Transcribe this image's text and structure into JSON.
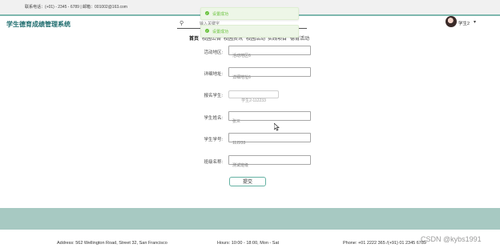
{
  "topbar": {
    "contact": "联系电话：(+01) - 2345 - 6789 | 邮箱：001002@163.com"
  },
  "brand": {
    "title": "学生德育成绩管理系统"
  },
  "search": {
    "placeholder": "输入关键字"
  },
  "user": {
    "name": "学生2",
    "caret": "▾"
  },
  "nav": {
    "items": [
      "首页",
      "校园公告",
      "校园资讯",
      "校园活动",
      "实践项目",
      "德育活动"
    ]
  },
  "toasts": [
    {
      "text": "设置成功"
    },
    {
      "text": "设置成功"
    }
  ],
  "form": {
    "fields": [
      {
        "label": "活动地区:",
        "value": "活动地区6"
      },
      {
        "label": "详细地址:",
        "value": "详细地址6"
      },
      {
        "label": "报名学生:",
        "value": "学生2-112233"
      },
      {
        "label": "学生姓名:",
        "value": "张三"
      },
      {
        "label": "学生学号:",
        "value": "112233"
      },
      {
        "label": "班级名称:",
        "value": "测试班级"
      }
    ],
    "submit_label": "提交"
  },
  "footer": {
    "address": "Address: 562 Wellington Road, Street 32, San Francisco",
    "hours": "Hours: 10:00 - 18:00, Mon - Sat",
    "phone": "Phone: +01 2222 365 /(+91) 01 2345 6789",
    "watermark": "CSDN @kybs1991"
  },
  "colors": {
    "accent": "#7eb8ae",
    "band": "#a7c9c2",
    "brand": "#1d6b6d",
    "toast_bg": "#edf6e7",
    "toast_text": "#67c23a"
  }
}
